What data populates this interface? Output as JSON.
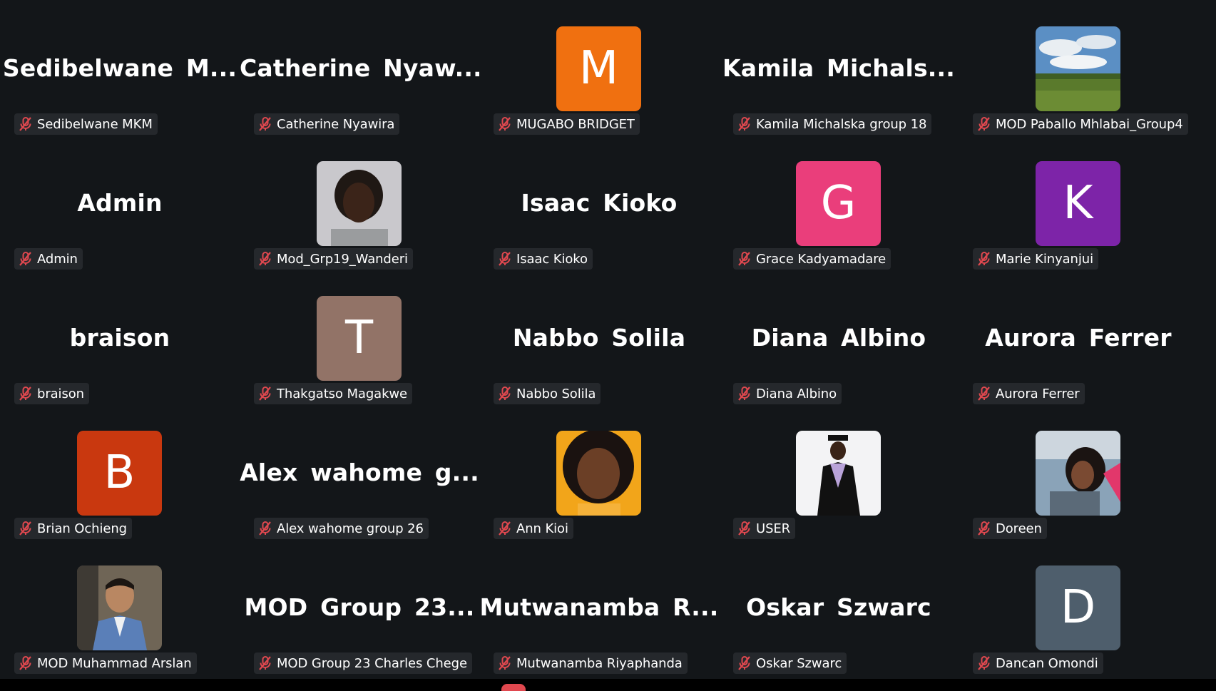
{
  "participants": [
    {
      "display_name": "Sedibelwane  M...",
      "label": "Sedibelwane MKM",
      "avatar": "none"
    },
    {
      "display_name": "Catherine  Nyaw...",
      "label": "Catherine Nyawira",
      "avatar": "none"
    },
    {
      "display_name": "",
      "label": "MUGABO BRIDGET",
      "avatar": "letter",
      "letter": "M",
      "color": "#f07010"
    },
    {
      "display_name": "Kamila  Michals...",
      "label": "Kamila Michalska group 18",
      "avatar": "none"
    },
    {
      "display_name": "",
      "label": "MOD Paballo Mhlabai_Group4",
      "avatar": "photo",
      "photo": "landscape-photo"
    },
    {
      "display_name": "Admin",
      "label": "Admin",
      "avatar": "none"
    },
    {
      "display_name": "",
      "label": "Mod_Grp19_Wanderi",
      "avatar": "photo",
      "photo": "dreadlocks-portrait-photo"
    },
    {
      "display_name": "Isaac Kioko",
      "label": "Isaac Kioko",
      "avatar": "none"
    },
    {
      "display_name": "",
      "label": "Grace Kadyamadare",
      "avatar": "letter",
      "letter": "G",
      "color": "#ea3e7b"
    },
    {
      "display_name": "",
      "label": "Marie Kinyanjui",
      "avatar": "letter",
      "letter": "K",
      "color": "#7d24a8"
    },
    {
      "display_name": "braison",
      "label": "braison",
      "avatar": "none"
    },
    {
      "display_name": "",
      "label": "Thakgatso Magakwe",
      "avatar": "letter",
      "letter": "T",
      "color": "#927367"
    },
    {
      "display_name": "Nabbo Solila",
      "label": "Nabbo Solila",
      "avatar": "none"
    },
    {
      "display_name": "Diana Albino",
      "label": "Diana Albino",
      "avatar": "none"
    },
    {
      "display_name": "Aurora Ferrer",
      "label": "Aurora Ferrer",
      "avatar": "none"
    },
    {
      "display_name": "",
      "label": "Brian Ochieng",
      "avatar": "letter",
      "letter": "B",
      "color": "#c9380f"
    },
    {
      "display_name": "Alex  wahome  g...",
      "label": "Alex wahome group 26",
      "avatar": "none"
    },
    {
      "display_name": "",
      "label": "Ann Kioi",
      "avatar": "photo",
      "photo": "woman-portrait-photo"
    },
    {
      "display_name": "",
      "label": "USER",
      "avatar": "photo",
      "photo": "graduate-photo"
    },
    {
      "display_name": "",
      "label": "Doreen",
      "avatar": "photo",
      "photo": "selfie-photo"
    },
    {
      "display_name": "",
      "label": "MOD Muhammad Arslan",
      "avatar": "photo",
      "photo": "man-suit-photo"
    },
    {
      "display_name": "MOD  Group  23...",
      "label": "MOD Group 23 Charles Chege",
      "avatar": "none"
    },
    {
      "display_name": "Mutwanamba  R...",
      "label": "Mutwanamba Riyaphanda",
      "avatar": "none"
    },
    {
      "display_name": "Oskar Szwarc",
      "label": "Oskar Szwarc",
      "avatar": "none"
    },
    {
      "display_name": "",
      "label": "Dancan Omondi",
      "avatar": "letter",
      "letter": "D",
      "color": "#4e5e6c"
    }
  ],
  "icons": {
    "muted": "microphone-muted-icon"
  },
  "colors": {
    "background": "#131619",
    "label_background": "#25282c",
    "muted_icon": "#e0484f"
  }
}
